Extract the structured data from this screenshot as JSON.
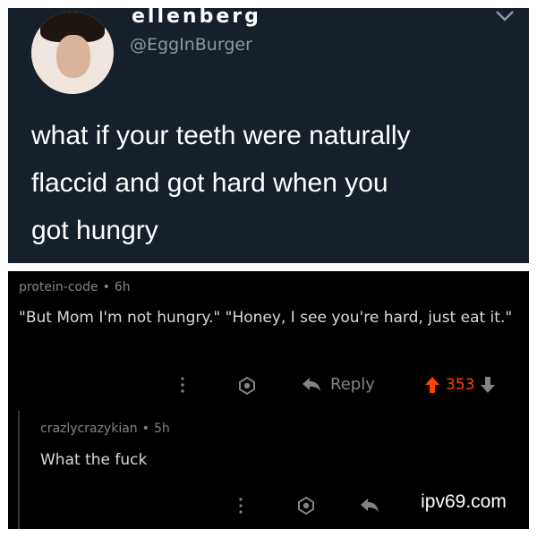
{
  "tweet": {
    "display_name": "ellenberg",
    "handle": "@EggInBurger",
    "text_lines": [
      "what if your teeth were naturally",
      "flaccid and got hard when you",
      "got hungry"
    ]
  },
  "comment": {
    "username": "protein-code",
    "separator": "•",
    "age": "6h",
    "text": "\"But Mom I'm not hungry.\" \"Honey, I see you're hard, just eat it.\"",
    "reply_label": "Reply",
    "score": "353"
  },
  "reply": {
    "username": "crazlycrazykian",
    "separator": "•",
    "age": "5h",
    "text": "What the fuck"
  },
  "watermark": "ipv69.com",
  "colors": {
    "tweet_bg": "#15202b",
    "reddit_bg": "#000000",
    "upvote": "#ff4500",
    "muted": "#818384"
  },
  "icons": {
    "more": "more-vertical-icon",
    "award": "award-icon",
    "reply": "reply-arrow-icon",
    "upvote": "upvote-arrow-icon",
    "downvote": "downvote-arrow-icon",
    "chevron": "chevron-down-icon"
  }
}
